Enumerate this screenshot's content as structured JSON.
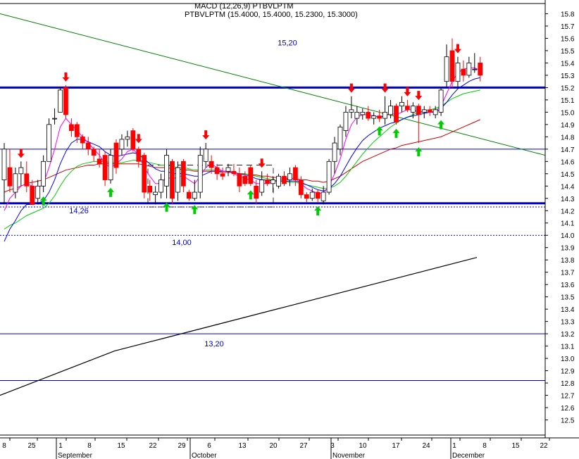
{
  "chart_data": {
    "type": "candlestick",
    "title": "PTBVLPTM (15.4000, 15.4000, 15.2300, 15.3000)",
    "overlay_text": "MACD (12,26,9) PTBVLPTM",
    "ylim": [
      12.4,
      15.9
    ],
    "y_ticks": [
      12.5,
      12.6,
      12.7,
      12.8,
      12.9,
      13.0,
      13.1,
      13.2,
      13.3,
      13.4,
      13.5,
      13.6,
      13.7,
      13.8,
      13.9,
      14.0,
      14.1,
      14.2,
      14.3,
      14.4,
      14.5,
      14.6,
      14.7,
      14.8,
      14.9,
      15.0,
      15.1,
      15.2,
      15.3,
      15.4,
      15.5,
      15.6,
      15.7,
      15.8
    ],
    "x_labels": [
      "8",
      "25",
      "1",
      "8",
      "15",
      "22",
      "29",
      "6",
      "13",
      "20",
      "27",
      "3",
      "10",
      "17",
      "24",
      "1",
      "8",
      "15",
      "22"
    ],
    "months": [
      "September",
      "October",
      "November",
      "December"
    ],
    "candles": [
      {
        "o": 14.45,
        "h": 14.75,
        "l": 14.25,
        "c": 14.7
      },
      {
        "o": 14.55,
        "h": 14.7,
        "l": 14.35,
        "c": 14.4
      },
      {
        "o": 14.35,
        "h": 14.55,
        "l": 14.3,
        "c": 14.5
      },
      {
        "o": 14.5,
        "h": 14.6,
        "l": 14.4,
        "c": 14.55
      },
      {
        "o": 14.5,
        "h": 14.6,
        "l": 14.35,
        "c": 14.4
      },
      {
        "o": 14.4,
        "h": 14.45,
        "l": 14.25,
        "c": 14.25
      },
      {
        "o": 14.3,
        "h": 14.45,
        "l": 14.25,
        "c": 14.4
      },
      {
        "o": 14.4,
        "h": 14.65,
        "l": 14.35,
        "c": 14.6
      },
      {
        "o": 14.6,
        "h": 14.95,
        "l": 14.6,
        "c": 14.9
      },
      {
        "o": 14.95,
        "h": 15.03,
        "l": 14.9,
        "c": 14.95
      },
      {
        "o": 15.0,
        "h": 15.2,
        "l": 15.0,
        "c": 15.18
      },
      {
        "o": 15.2,
        "h": 15.22,
        "l": 14.95,
        "c": 14.98
      },
      {
        "o": 14.9,
        "h": 14.95,
        "l": 14.8,
        "c": 14.85
      },
      {
        "o": 14.9,
        "h": 14.92,
        "l": 14.75,
        "c": 14.8
      },
      {
        "o": 14.8,
        "h": 14.82,
        "l": 14.7,
        "c": 14.75
      },
      {
        "o": 14.75,
        "h": 14.8,
        "l": 14.65,
        "c": 14.7
      },
      {
        "o": 14.7,
        "h": 14.72,
        "l": 14.6,
        "c": 14.65
      },
      {
        "o": 14.62,
        "h": 14.7,
        "l": 14.55,
        "c": 14.58
      },
      {
        "o": 14.65,
        "h": 14.68,
        "l": 14.4,
        "c": 14.45
      },
      {
        "o": 14.45,
        "h": 14.7,
        "l": 14.42,
        "c": 14.65
      },
      {
        "o": 14.75,
        "h": 14.78,
        "l": 14.5,
        "c": 14.55
      },
      {
        "o": 14.7,
        "h": 14.82,
        "l": 14.65,
        "c": 14.78
      },
      {
        "o": 14.78,
        "h": 14.85,
        "l": 14.72,
        "c": 14.8
      },
      {
        "o": 14.85,
        "h": 14.87,
        "l": 14.68,
        "c": 14.7
      },
      {
        "o": 14.7,
        "h": 14.72,
        "l": 14.55,
        "c": 14.6
      },
      {
        "o": 14.65,
        "h": 14.67,
        "l": 14.3,
        "c": 14.35
      },
      {
        "o": 14.4,
        "h": 14.45,
        "l": 14.28,
        "c": 14.35
      },
      {
        "o": 14.33,
        "h": 14.4,
        "l": 14.25,
        "c": 14.35
      },
      {
        "o": 14.35,
        "h": 14.5,
        "l": 14.3,
        "c": 14.45
      },
      {
        "o": 14.4,
        "h": 14.7,
        "l": 14.3,
        "c": 14.65
      },
      {
        "o": 14.6,
        "h": 14.62,
        "l": 14.25,
        "c": 14.3
      },
      {
        "o": 14.35,
        "h": 14.6,
        "l": 14.28,
        "c": 14.55
      },
      {
        "o": 14.6,
        "h": 14.62,
        "l": 14.35,
        "c": 14.4
      },
      {
        "o": 14.35,
        "h": 14.37,
        "l": 14.28,
        "c": 14.3
      },
      {
        "o": 14.3,
        "h": 14.45,
        "l": 14.28,
        "c": 14.35
      },
      {
        "o": 14.35,
        "h": 14.72,
        "l": 14.3,
        "c": 14.65
      },
      {
        "o": 14.6,
        "h": 14.75,
        "l": 14.55,
        "c": 14.7
      },
      {
        "o": 14.6,
        "h": 14.65,
        "l": 14.5,
        "c": 14.55
      },
      {
        "o": 14.55,
        "h": 14.58,
        "l": 14.45,
        "c": 14.5
      },
      {
        "o": 14.5,
        "h": 14.55,
        "l": 14.45,
        "c": 14.48
      },
      {
        "o": 14.52,
        "h": 14.58,
        "l": 14.48,
        "c": 14.55
      },
      {
        "o": 14.52,
        "h": 14.58,
        "l": 14.48,
        "c": 14.5
      },
      {
        "o": 14.5,
        "h": 14.55,
        "l": 14.35,
        "c": 14.4
      },
      {
        "o": 14.48,
        "h": 14.52,
        "l": 14.4,
        "c": 14.42
      },
      {
        "o": 14.55,
        "h": 14.57,
        "l": 14.4,
        "c": 14.42
      },
      {
        "o": 14.4,
        "h": 14.45,
        "l": 14.25,
        "c": 14.3
      },
      {
        "o": 14.35,
        "h": 14.52,
        "l": 14.32,
        "c": 14.45
      },
      {
        "o": 14.45,
        "h": 14.5,
        "l": 14.4,
        "c": 14.42
      },
      {
        "o": 14.42,
        "h": 14.48,
        "l": 14.35,
        "c": 14.45
      },
      {
        "o": 14.4,
        "h": 14.5,
        "l": 14.38,
        "c": 14.48
      },
      {
        "o": 14.48,
        "h": 14.52,
        "l": 14.4,
        "c": 14.42
      },
      {
        "o": 14.45,
        "h": 14.55,
        "l": 14.4,
        "c": 14.5
      },
      {
        "o": 14.55,
        "h": 14.57,
        "l": 14.4,
        "c": 14.45
      },
      {
        "o": 14.45,
        "h": 14.48,
        "l": 14.3,
        "c": 14.33
      },
      {
        "o": 14.33,
        "h": 14.35,
        "l": 14.27,
        "c": 14.3
      },
      {
        "o": 14.3,
        "h": 14.38,
        "l": 14.28,
        "c": 14.35
      },
      {
        "o": 14.35,
        "h": 14.37,
        "l": 14.27,
        "c": 14.3
      },
      {
        "o": 14.28,
        "h": 14.4,
        "l": 14.25,
        "c": 14.35
      },
      {
        "o": 14.35,
        "h": 14.62,
        "l": 14.33,
        "c": 14.6
      },
      {
        "o": 14.6,
        "h": 14.8,
        "l": 14.5,
        "c": 14.75
      },
      {
        "o": 14.7,
        "h": 14.9,
        "l": 14.65,
        "c": 14.88
      },
      {
        "o": 14.85,
        "h": 15.05,
        "l": 14.8,
        "c": 15.0
      },
      {
        "o": 15.0,
        "h": 15.13,
        "l": 14.95,
        "c": 15.02
      },
      {
        "o": 14.95,
        "h": 15.05,
        "l": 14.9,
        "c": 15.0
      },
      {
        "o": 14.98,
        "h": 15.03,
        "l": 14.94,
        "c": 15.0
      },
      {
        "o": 15.0,
        "h": 15.05,
        "l": 14.93,
        "c": 14.95
      },
      {
        "o": 14.95,
        "h": 15.0,
        "l": 14.9,
        "c": 14.97
      },
      {
        "o": 14.97,
        "h": 15.02,
        "l": 14.92,
        "c": 14.95
      },
      {
        "o": 14.95,
        "h": 15.13,
        "l": 14.9,
        "c": 15.0
      },
      {
        "o": 14.98,
        "h": 15.1,
        "l": 14.95,
        "c": 15.05
      },
      {
        "o": 15.05,
        "h": 15.07,
        "l": 14.9,
        "c": 14.92
      },
      {
        "o": 15.05,
        "h": 15.13,
        "l": 15.0,
        "c": 15.08
      },
      {
        "o": 15.05,
        "h": 15.1,
        "l": 15.0,
        "c": 15.02
      },
      {
        "o": 15.0,
        "h": 15.08,
        "l": 14.95,
        "c": 15.05
      },
      {
        "o": 15.05,
        "h": 15.07,
        "l": 14.75,
        "c": 14.98
      },
      {
        "o": 15.0,
        "h": 15.05,
        "l": 14.95,
        "c": 15.02
      },
      {
        "o": 15.02,
        "h": 15.05,
        "l": 14.97,
        "c": 15.0
      },
      {
        "o": 14.98,
        "h": 15.05,
        "l": 14.95,
        "c": 15.02
      },
      {
        "o": 15.0,
        "h": 15.2,
        "l": 14.97,
        "c": 15.18
      },
      {
        "o": 15.25,
        "h": 15.55,
        "l": 15.2,
        "c": 15.45
      },
      {
        "o": 15.5,
        "h": 15.6,
        "l": 15.2,
        "c": 15.25
      },
      {
        "o": 15.25,
        "h": 15.45,
        "l": 15.2,
        "c": 15.4
      },
      {
        "o": 15.35,
        "h": 15.42,
        "l": 15.25,
        "c": 15.3
      },
      {
        "o": 15.3,
        "h": 15.45,
        "l": 15.28,
        "c": 15.4
      },
      {
        "o": 15.35,
        "h": 15.48,
        "l": 15.32,
        "c": 15.35
      },
      {
        "o": 15.4,
        "h": 15.45,
        "l": 15.25,
        "c": 15.3
      }
    ],
    "ma_fast": [
      14.2,
      14.3,
      14.35,
      14.4,
      14.42,
      14.4,
      14.38,
      14.42,
      14.55,
      14.7,
      14.88,
      14.95,
      14.9,
      14.85,
      14.8,
      14.75,
      14.7,
      14.65,
      14.58,
      14.55,
      14.58,
      14.62,
      14.68,
      14.7,
      14.65,
      14.55,
      14.48,
      14.42,
      14.42,
      14.48,
      14.45,
      14.48,
      14.48,
      14.45,
      14.42,
      14.48,
      14.55,
      14.58,
      14.55,
      14.52,
      14.52,
      14.5,
      14.48,
      14.46,
      14.45,
      14.42,
      14.42,
      14.42,
      14.43,
      14.45,
      14.45,
      14.46,
      14.46,
      14.42,
      14.38,
      14.36,
      14.34,
      14.34,
      14.4,
      14.5,
      14.62,
      14.78,
      14.9,
      14.96,
      14.98,
      14.98,
      14.97,
      14.96,
      14.97,
      14.99,
      14.98,
      15.0,
      15.02,
      15.02,
      15.0,
      15.0,
      15.0,
      15.01,
      15.05,
      15.15,
      15.25,
      15.32,
      15.35,
      15.36,
      15.36,
      15.34
    ],
    "ma_mid": [
      13.95,
      14.05,
      14.12,
      14.2,
      14.25,
      14.25,
      14.26,
      14.28,
      14.35,
      14.45,
      14.58,
      14.68,
      14.75,
      14.78,
      14.78,
      14.76,
      14.74,
      14.72,
      14.68,
      14.65,
      14.64,
      14.65,
      14.66,
      14.67,
      14.66,
      14.62,
      14.58,
      14.54,
      14.52,
      14.52,
      14.5,
      14.5,
      14.5,
      14.49,
      14.48,
      14.48,
      14.5,
      14.52,
      14.52,
      14.52,
      14.52,
      14.51,
      14.5,
      14.49,
      14.48,
      14.46,
      14.45,
      14.45,
      14.44,
      14.44,
      14.44,
      14.44,
      14.44,
      14.43,
      14.41,
      14.39,
      14.37,
      14.36,
      14.38,
      14.42,
      14.48,
      14.56,
      14.64,
      14.71,
      14.77,
      14.81,
      14.84,
      14.87,
      14.89,
      14.91,
      14.92,
      14.94,
      14.96,
      14.97,
      14.98,
      14.99,
      15.0,
      15.0,
      15.03,
      15.08,
      15.14,
      15.19,
      15.22,
      15.25,
      15.27,
      15.28
    ],
    "ma_green": [
      14.05,
      14.08,
      14.1,
      14.13,
      14.16,
      14.18,
      14.2,
      14.22,
      14.26,
      14.32,
      14.4,
      14.47,
      14.52,
      14.56,
      14.58,
      14.59,
      14.6,
      14.6,
      14.6,
      14.59,
      14.59,
      14.59,
      14.6,
      14.61,
      14.61,
      14.6,
      14.59,
      14.58,
      14.57,
      14.57,
      14.56,
      14.55,
      14.55,
      14.54,
      14.53,
      14.53,
      14.53,
      14.53,
      14.53,
      14.52,
      14.52,
      14.51,
      14.5,
      14.5,
      14.49,
      14.48,
      14.47,
      14.46,
      14.45,
      14.44,
      14.44,
      14.43,
      14.43,
      14.42,
      14.41,
      14.4,
      14.39,
      14.38,
      14.38,
      14.4,
      14.43,
      14.48,
      14.54,
      14.6,
      14.66,
      14.71,
      14.76,
      14.8,
      14.84,
      14.88,
      14.91,
      14.94,
      14.96,
      14.98,
      15.0,
      15.01,
      15.02,
      15.03,
      15.05,
      15.08,
      15.11,
      15.13,
      15.15,
      15.16,
      15.17,
      15.18
    ],
    "ma_red": [
      14.35,
      14.37,
      14.38,
      14.4,
      14.42,
      14.43,
      14.44,
      14.45,
      14.47,
      14.49,
      14.51,
      14.53,
      14.54,
      14.55,
      14.56,
      14.57,
      14.57,
      14.58,
      14.58,
      14.58,
      14.58,
      14.58,
      14.58,
      14.58,
      14.58,
      14.57,
      14.56,
      14.55,
      14.55,
      14.55,
      14.54,
      14.54,
      14.53,
      14.53,
      14.52,
      14.52,
      14.52,
      14.52,
      14.52,
      14.51,
      14.51,
      14.51,
      14.5,
      14.5,
      14.49,
      14.49,
      14.48,
      14.48,
      14.47,
      14.47,
      14.46,
      14.46,
      14.46,
      14.45,
      14.45,
      14.44,
      14.44,
      14.43,
      14.44,
      14.46,
      14.48,
      14.51,
      14.54,
      14.57,
      14.6,
      14.62,
      14.64,
      14.66,
      14.68,
      14.7,
      14.71,
      14.73,
      14.74,
      14.75,
      14.76,
      14.77,
      14.78,
      14.79,
      14.8,
      14.82,
      14.84,
      14.86,
      14.88,
      14.9,
      14.92,
      14.94
    ],
    "long_ma": [
      12.7,
      12.73,
      12.76,
      12.79,
      12.82,
      12.85,
      12.88,
      12.91,
      12.94,
      12.97,
      13.0,
      13.03,
      13.06,
      13.08,
      13.1,
      13.12,
      13.14,
      13.16,
      13.18,
      13.2,
      13.22,
      13.24,
      13.26,
      13.28,
      13.3,
      13.32,
      13.34,
      13.36,
      13.38,
      13.4,
      13.42,
      13.44,
      13.46,
      13.48,
      13.5,
      13.52,
      13.54,
      13.56,
      13.58,
      13.6,
      13.62,
      13.64,
      13.66,
      13.68,
      13.7,
      13.72,
      13.74,
      13.76,
      13.78,
      13.8,
      13.82
    ],
    "hlines": [
      {
        "y": 15.2,
        "label": "15,20",
        "style": "bold"
      },
      {
        "y": 14.26,
        "label": "14,26",
        "style": "bold"
      },
      {
        "y": 14.7,
        "label": "",
        "style": "thin"
      },
      {
        "y": 14.0,
        "label": "14,00",
        "style": "dotted"
      },
      {
        "y": 14.23,
        "label": "",
        "style": "dotted"
      },
      {
        "y": 13.2,
        "label": "13,20",
        "style": "thin"
      },
      {
        "y": 12.82,
        "label": "",
        "style": "thin"
      }
    ],
    "down_arrows": [
      3,
      11,
      24,
      36,
      46,
      62,
      68,
      72,
      74,
      81
    ],
    "up_arrows": [
      7,
      19,
      29,
      34,
      44,
      56,
      67,
      70,
      74,
      78
    ],
    "colors": {
      "up": "#ffffff",
      "down": "#ff0000",
      "level": "#0000cc",
      "trend": "#008000",
      "ma_fast": "#ff00ff",
      "ma_mid": "#0000ff",
      "ma_green": "#00cc00",
      "ma_red": "#cc0000",
      "arrow_down": "#ff0000",
      "arrow_up": "#00cc00"
    }
  }
}
